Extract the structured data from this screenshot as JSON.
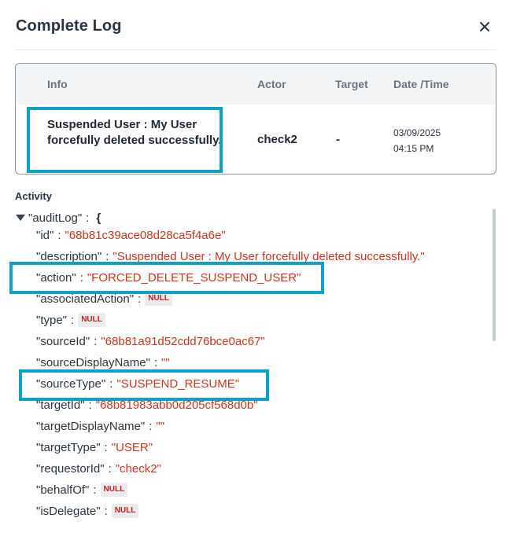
{
  "modal": {
    "title": "Complete Log",
    "close_icon": "close-icon"
  },
  "table": {
    "headers": {
      "info": "Info",
      "actor": "Actor",
      "target": "Target",
      "datetime": "Date /Time"
    },
    "row": {
      "info": "Suspended User : My User forcefully deleted successfully.",
      "actor": "check2",
      "target": "-",
      "date": "03/09/2025",
      "time": "04:15 PM"
    }
  },
  "activity": {
    "label": "Activity",
    "root_key": "\"auditLog\"",
    "root_brace": "{",
    "colon": ":",
    "null_badge": "NULL",
    "fields": [
      {
        "key": "\"id\"",
        "value": "\"68b81c39ace08d28ca5f4a6e\"",
        "is_null": false
      },
      {
        "key": "\"description\"",
        "value": "\"Suspended User : My User forcefully deleted successfully.\"",
        "is_null": false
      },
      {
        "key": "\"action\"",
        "value": "\"FORCED_DELETE_SUSPEND_USER\"",
        "is_null": false
      },
      {
        "key": "\"associatedAction\"",
        "value": "NULL",
        "is_null": true
      },
      {
        "key": "\"type\"",
        "value": "NULL",
        "is_null": true
      },
      {
        "key": "\"sourceId\"",
        "value": "\"68b81a91d52cdd76bce0ac67\"",
        "is_null": false
      },
      {
        "key": "\"sourceDisplayName\"",
        "value": "\"\"",
        "is_null": false
      },
      {
        "key": "\"sourceType\"",
        "value": "\"SUSPEND_RESUME\"",
        "is_null": false
      },
      {
        "key": "\"targetId\"",
        "value": "\"68b81983abb0d205cf568d0b\"",
        "is_null": false
      },
      {
        "key": "\"targetDisplayName\"",
        "value": "\"\"",
        "is_null": false
      },
      {
        "key": "\"targetType\"",
        "value": "\"USER\"",
        "is_null": false
      },
      {
        "key": "\"requestorId\"",
        "value": "\"check2\"",
        "is_null": false
      },
      {
        "key": "\"behalfOf\"",
        "value": "NULL",
        "is_null": true
      },
      {
        "key": "\"isDelegate\"",
        "value": "NULL",
        "is_null": true
      }
    ]
  },
  "colors": {
    "highlight": "#0ea1c4",
    "string": "#c7361d",
    "null_text": "#c0211a"
  }
}
